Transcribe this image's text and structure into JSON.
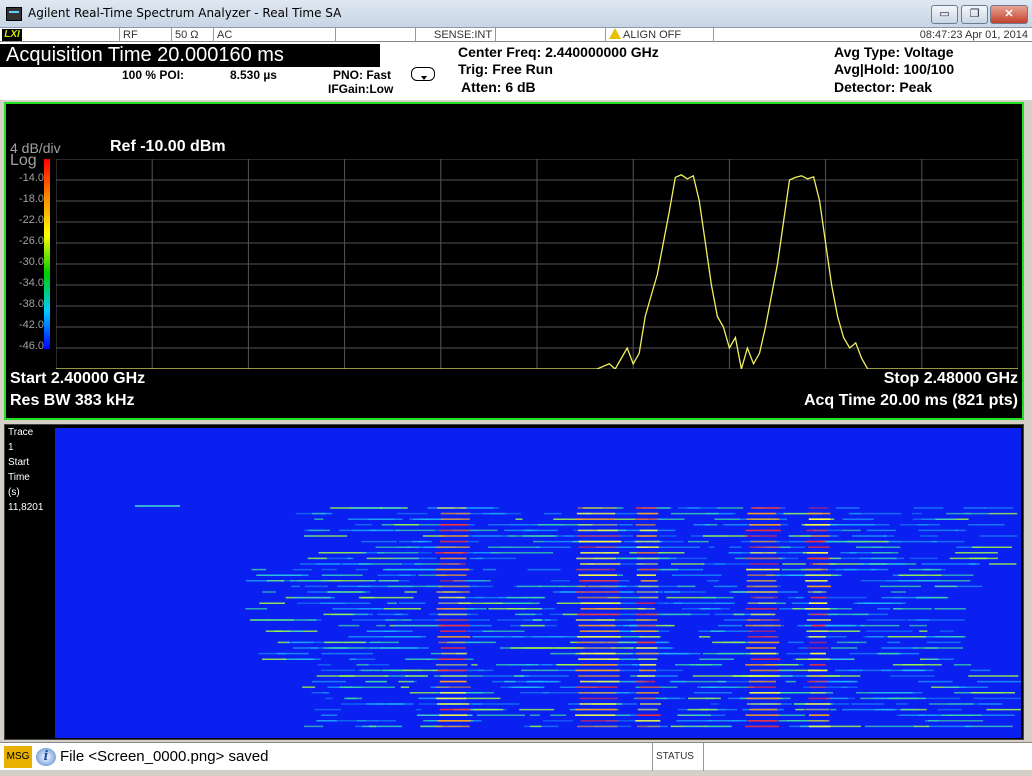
{
  "window": {
    "title": "Agilent Real-Time Spectrum Analyzer - Real Time SA",
    "min_symbol": "▭",
    "max_symbol": "❐",
    "close_symbol": "✕"
  },
  "strip": {
    "lxi": "LXI",
    "rf": "RF",
    "impedance": "50 Ω",
    "coupling": "AC",
    "sense": "SENSE:INT",
    "align": "ALIGN OFF",
    "timestamp": "08:47:23 Apr 01, 2014"
  },
  "header": {
    "acq_time": "Acquisition Time 20.000160 ms",
    "poi_label": "100 % POI:",
    "poi_value": "8.530 µs",
    "pno": "PNO: Fast",
    "ifgain": "IFGain:Low",
    "center_freq": "Center Freq: 2.440000000 GHz",
    "trig": "Trig: Free Run",
    "atten": "Atten: 6 dB",
    "avg_type": "Avg Type: Voltage",
    "avg_hold": "Avg|Hold: 100/100",
    "detector": "Detector: Peak"
  },
  "spectrum": {
    "scale": "4 dB/div",
    "ref": "Ref -10.00 dBm",
    "log": "Log",
    "start": "Start 2.40000 GHz",
    "stop": "Stop 2.48000 GHz",
    "res_bw": "Res BW 383 kHz",
    "acq": "Acq Time  20.00 ms (821 pts)",
    "trace_color": "#f0f060"
  },
  "chart_data": {
    "type": "line",
    "xlabel": "",
    "ylabel": "",
    "xlim": [
      2.4,
      2.48
    ],
    "ylim": [
      -50,
      -10
    ],
    "y_ticks": [
      "-14.0",
      "-18.0",
      "-22.0",
      "-26.0",
      "-30.0",
      "-34.0",
      "-38.0",
      "-42.0",
      "-46.0"
    ],
    "grid": true,
    "series": [
      {
        "name": "",
        "x": [
          2.4,
          2.445,
          2.446,
          2.4465,
          2.447,
          2.4475,
          2.448,
          2.4485,
          2.449,
          2.4495,
          2.45,
          2.4505,
          2.451,
          2.4515,
          2.452,
          2.4525,
          2.453,
          2.4535,
          2.454,
          2.4545,
          2.455,
          2.4555,
          2.456,
          2.4565,
          2.457,
          2.4575,
          2.458,
          2.4585,
          2.459,
          2.4595,
          2.46,
          2.4605,
          2.461,
          2.4615,
          2.462,
          2.4625,
          2.463,
          2.4635,
          2.464,
          2.4645,
          2.465,
          2.4655,
          2.466,
          2.4665,
          2.467,
          2.4675,
          2.48
        ],
        "y": [
          -50,
          -50,
          -49,
          -50,
          -48,
          -46,
          -49,
          -47,
          -40,
          -36,
          -32,
          -26,
          -20,
          -13.5,
          -13,
          -13.8,
          -13.2,
          -18,
          -26,
          -34,
          -40,
          -42,
          -46,
          -44,
          -50,
          -46,
          -49,
          -47,
          -42,
          -36,
          -30,
          -22,
          -14,
          -13.5,
          -13.2,
          -13.8,
          -13.4,
          -18,
          -26,
          -34,
          -40,
          -44,
          -46,
          -45,
          -48,
          -50,
          -50
        ]
      }
    ]
  },
  "waterfall": {
    "label_lines": [
      "Trace",
      "1",
      "Start",
      "Time",
      "(s)",
      "11,8201"
    ],
    "bg_color": "#0a20f0"
  },
  "message": {
    "label": "MSG",
    "icon": "i",
    "text": "File <Screen_0000.png> saved",
    "status": "STATUS"
  }
}
